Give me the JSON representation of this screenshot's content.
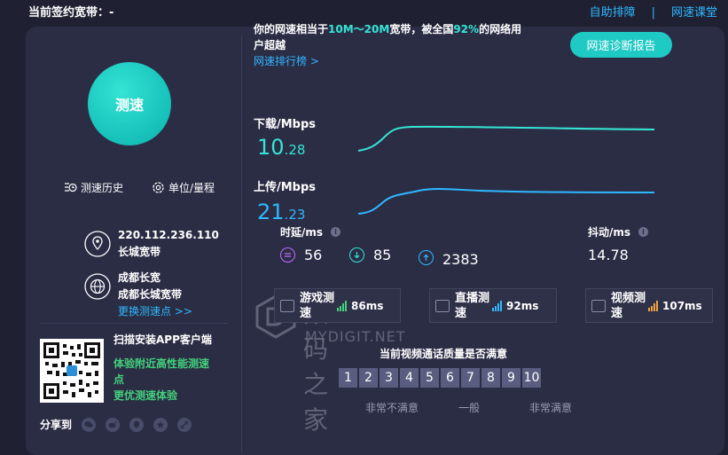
{
  "top": {
    "bandwidth_label": "当前签约宽带：-",
    "link_self_check": "自助排障",
    "separator": "|",
    "link_classroom": "网速课堂"
  },
  "left": {
    "speed_button": "测速",
    "history": "测速历史",
    "unit": "单位/量程",
    "ip": "220.112.236.110",
    "isp": "长城宽带",
    "node_city": "成都长宽",
    "node_name": "成都长城宽带",
    "change_node": "更换测速点 >>",
    "qr_title": "扫描安装APP客户端",
    "qr_line1": "体验附近高性能测速点",
    "qr_line2": "更优测速体验",
    "share_label": "分享到"
  },
  "summary": {
    "prefix": "你的网速相当于",
    "range": "10M～20M",
    "mid": "宽带，被全国",
    "percent": "92%",
    "suffix": "的网络用户超越",
    "rank_link": "网速排行榜 >",
    "report_button": "网速诊断报告"
  },
  "download": {
    "label": "下载/Mbps",
    "int": "10",
    "dec": ".28",
    "value": 10.28
  },
  "upload": {
    "label": "上传/Mbps",
    "int": "21",
    "dec": ".23",
    "value": 21.23
  },
  "latency": {
    "label": "时延/ms",
    "q": "i",
    "v1": "56",
    "v2": "85",
    "v3": "2383"
  },
  "jitter": {
    "label": "抖动/ms",
    "q": "i",
    "value": "14.78"
  },
  "scenes": [
    {
      "name": "游戏测速",
      "ms": "86ms"
    },
    {
      "name": "直播测速",
      "ms": "92ms"
    },
    {
      "name": "视频测速",
      "ms": "107ms"
    }
  ],
  "watermark": {
    "cn": "数码之家",
    "en": "MYDIGIT.NET"
  },
  "rating": {
    "title": "当前视频通话质量是否满意",
    "scores": [
      "1",
      "2",
      "3",
      "4",
      "5",
      "6",
      "7",
      "8",
      "9",
      "10"
    ],
    "low": "非常不满意",
    "mid": "一般",
    "high": "非常满意"
  },
  "colors": {
    "accent_teal": "#35e4d4",
    "accent_blue": "#2fb8ff",
    "green": "#43d17c",
    "panel": "#2b2d45",
    "background": "#1f2031"
  }
}
